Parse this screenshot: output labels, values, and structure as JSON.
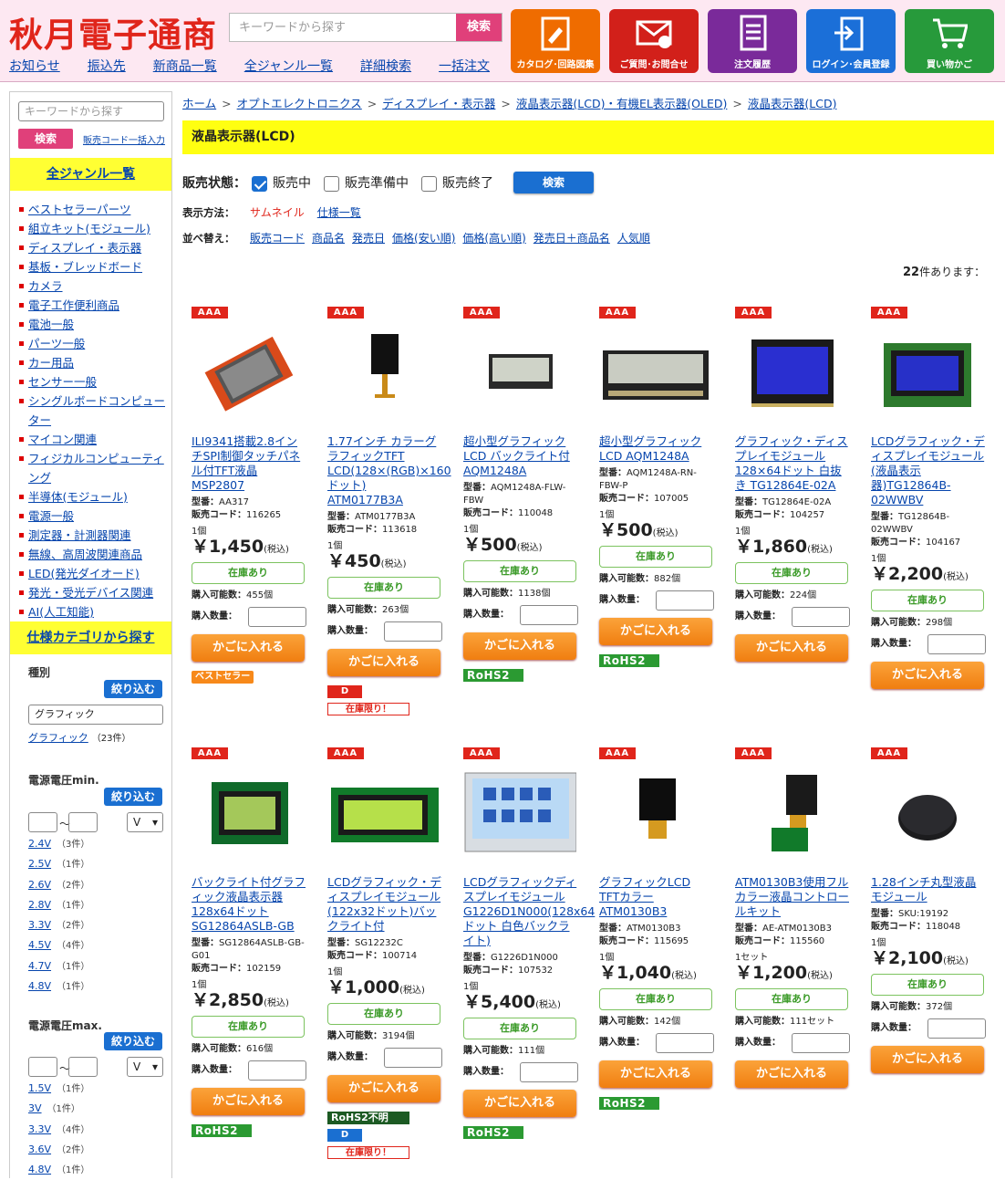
{
  "header": {
    "logo": "秋月電子通商",
    "search_placeholder": "キーワードから探す",
    "search_btn": "検索",
    "nav": [
      "お知らせ",
      "振込先",
      "新商品一覧",
      "全ジャンル一覧",
      "詳細検索",
      "一括注文"
    ],
    "icons": [
      {
        "label": "カタログ･回路図集",
        "color": "#ef6c00",
        "icon": "catalog-icon"
      },
      {
        "label": "ご質問･お問合せ",
        "color": "#d2201a",
        "icon": "mail-icon"
      },
      {
        "label": "注文履歴",
        "color": "#7a2a9a",
        "icon": "order-history-icon"
      },
      {
        "label": "ログイン･会員登録",
        "color": "#1b6fd8",
        "icon": "login-icon"
      },
      {
        "label": "買い物かご",
        "color": "#279a3b",
        "icon": "cart-icon"
      }
    ]
  },
  "sidebar": {
    "search_placeholder": "キーワードから探す",
    "search_btn": "検索",
    "bulk_link": "販売コード一括入力",
    "all_genres": "全ジャンル一覧",
    "genres": [
      "ベストセラーパーツ",
      "組立キット(モジュール)",
      "ディスプレイ・表示器",
      "基板・ブレッドボード",
      "カメラ",
      "電子工作便利商品",
      "電池一般",
      "パーツ一般",
      "カー用品",
      "センサー一般",
      "シングルボードコンピューター",
      "マイコン関連",
      "フィジカルコンピューティング",
      "半導体(モジュール)",
      "電源一般",
      "測定器・計測器関連",
      "無線、高周波関連商品",
      "LED(発光ダイオード)",
      "発光・受光デバイス関連",
      "AI(人工知能)"
    ],
    "spec_title": "仕様カテゴリから探す",
    "kind_label": "種別",
    "narrow_btn": "絞り込む",
    "kind_value": "グラフィック",
    "kind_link": "グラフィック",
    "kind_count": "（23件）",
    "vmin_label": "電源電圧min.",
    "vmax_label": "電源電圧max.",
    "tilde": "〜",
    "unit": "V",
    "vmin_list": [
      {
        "v": "2.4V",
        "c": "（3件）"
      },
      {
        "v": "2.5V",
        "c": "（1件）"
      },
      {
        "v": "2.6V",
        "c": "（2件）"
      },
      {
        "v": "2.8V",
        "c": "（1件）"
      },
      {
        "v": "3.3V",
        "c": "（2件）"
      },
      {
        "v": "4.5V",
        "c": "（4件）"
      },
      {
        "v": "4.7V",
        "c": "（1件）"
      },
      {
        "v": "4.8V",
        "c": "（1件）"
      }
    ],
    "vmax_list": [
      {
        "v": "1.5V",
        "c": "（1件）"
      },
      {
        "v": "3V",
        "c": "（1件）"
      },
      {
        "v": "3.3V",
        "c": "（4件）"
      },
      {
        "v": "3.6V",
        "c": "（2件）"
      },
      {
        "v": "4.8V",
        "c": "（1件）"
      }
    ]
  },
  "breadcrumb": [
    "ホーム",
    "オプトエレクトロニクス",
    "ディスプレイ・表示器",
    "液晶表示器(LCD)・有機EL表示器(OLED)",
    "液晶表示器(LCD)"
  ],
  "page_title": "液晶表示器(LCD)",
  "status": {
    "label": "販売状態：",
    "opts": [
      {
        "t": "販売中",
        "on": true
      },
      {
        "t": "販売準備中",
        "on": false
      },
      {
        "t": "販売終了",
        "on": false
      }
    ],
    "btn": "検索"
  },
  "display": {
    "label": "表示方法：",
    "opts": [
      "サムネイル",
      "仕様一覧"
    ]
  },
  "sort": {
    "label": "並べ替え：",
    "opts": [
      "販売コード",
      "商品名",
      "発売日",
      "価格(安い順)",
      "価格(高い順)",
      "発売日＋商品名",
      "人気順"
    ]
  },
  "count": {
    "num": "22",
    "suffix": "件あります："
  },
  "labels": {
    "model": "型番：",
    "code": "販売コード：",
    "stock": "在庫あり",
    "avail": "購入可能数：",
    "qty": "購入数量：",
    "cart": "かごに入れる",
    "tax": "(税込)",
    "aaa": "AAA"
  },
  "products": [
    {
      "name": "ILI9341搭載2.8インチSPI制御タッチパネル付TFT液晶 MSP2807",
      "model": "AA317",
      "code": "116265",
      "unit": "1個",
      "price": "￥1,450",
      "avail": "455個",
      "badges": [
        {
          "k": "best",
          "t": "ベストセラー"
        }
      ],
      "img": "tft"
    },
    {
      "name": "1.77インチ カラーグラフィックTFT LCD(128×(RGB)×160ドット) ATM0177B3A",
      "model": "ATM0177B3A",
      "code": "113618",
      "unit": "1個",
      "price": "￥450",
      "avail": "263個",
      "badges": [
        {
          "k": "d",
          "t": "D"
        },
        {
          "k": "limit",
          "t": "在庫限り！"
        }
      ],
      "img": "small"
    },
    {
      "name": "超小型グラフィックLCD バックライト付 AQM1248A",
      "model": "AQM1248A-FLW-FBW",
      "code": "110048",
      "unit": "1個",
      "price": "￥500",
      "avail": "1138個",
      "badges": [
        {
          "k": "rohs",
          "t": "RoHS2"
        }
      ],
      "img": "mini"
    },
    {
      "name": "超小型グラフィックLCD AQM1248A",
      "model": "AQM1248A-RN-FBW-P",
      "code": "107005",
      "unit": "1個",
      "price": "￥500",
      "avail": "882個",
      "badges": [
        {
          "k": "rohs",
          "t": "RoHS2"
        }
      ],
      "img": "wide"
    },
    {
      "name": "グラフィック・ディスプレイモジュール128×64ドット 白抜き TG12864E-02A",
      "model": "TG12864E-02A",
      "code": "104257",
      "unit": "1個",
      "price": "￥1,860",
      "avail": "224個",
      "badges": [],
      "img": "blue"
    },
    {
      "name": "LCDグラフィック・ディスプレイモジュール(液晶表示器)TG12864B-02WWBV",
      "model": "TG12864B-02WWBV",
      "code": "104167",
      "unit": "1個",
      "price": "￥2,200",
      "avail": "298個",
      "badges": [],
      "img": "blue2"
    },
    {
      "name": "バックライト付グラフィック液晶表示器128x64ドット SG12864ASLB-GB",
      "model": "SG12864ASLB-GB-G01",
      "code": "102159",
      "unit": "1個",
      "price": "￥2,850",
      "avail": "616個",
      "badges": [
        {
          "k": "rohs",
          "t": "RoHS2"
        }
      ],
      "img": "green"
    },
    {
      "name": "LCDグラフィック・ディスプレイモジュール(122x32ドット)バックライト付",
      "model": "SG12232C",
      "code": "100714",
      "unit": "1個",
      "price": "￥1,000",
      "avail": "3194個",
      "badges": [
        {
          "k": "rohsna",
          "t": "RoHS2不明"
        },
        {
          "k": "dblue",
          "t": "D"
        },
        {
          "k": "limit",
          "t": "在庫限り！"
        }
      ],
      "img": "green2"
    },
    {
      "name": "LCDグラフィックディスプレイモジュールG1226D1N000(128x64ドット 白色バックライト)",
      "model": "G1226D1N000",
      "code": "107532",
      "unit": "1個",
      "price": "￥5,400",
      "avail": "111個",
      "badges": [
        {
          "k": "rohs",
          "t": "RoHS2"
        }
      ],
      "img": "icons"
    },
    {
      "name": "グラフィックLCD TFTカラー ATM0130B3",
      "model": "ATM0130B3",
      "code": "115695",
      "unit": "1個",
      "price": "￥1,040",
      "avail": "142個",
      "badges": [
        {
          "k": "rohs",
          "t": "RoHS2"
        }
      ],
      "img": "sq"
    },
    {
      "name": "ATM0130B3使用フルカラー液晶コントロールキット",
      "model": "AE-ATM0130B3",
      "code": "115560",
      "unit": "1セット",
      "price": "￥1,200",
      "avail": "111セット",
      "badges": [],
      "img": "kit"
    },
    {
      "name": "1.28インチ丸型液晶モジュール",
      "model": "SKU:19192",
      "code": "118048",
      "unit": "1個",
      "price": "￥2,100",
      "avail": "372個",
      "badges": [],
      "img": "round"
    }
  ]
}
